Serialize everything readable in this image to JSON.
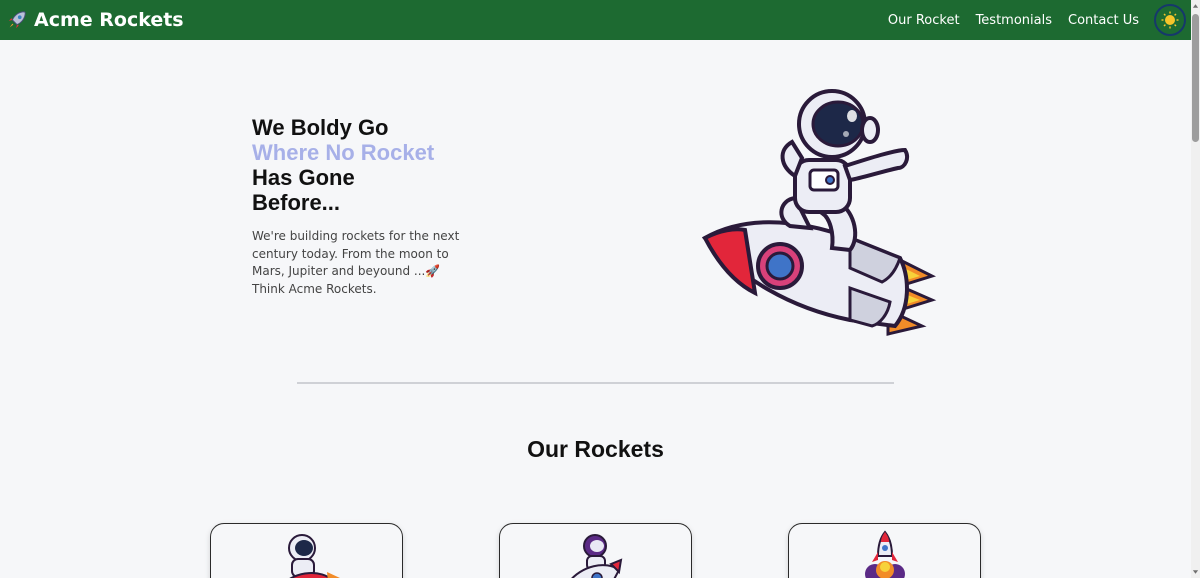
{
  "nav": {
    "brand": "Acme Rockets",
    "brand_icon": "rocket-icon",
    "links": [
      "Our Rocket",
      "Testmonials",
      "Contact Us"
    ],
    "theme_toggle_icon": "sun-icon",
    "colors": {
      "background": "#1d6a31",
      "text": "#ffffff"
    }
  },
  "hero": {
    "title_line1": "We Boldy Go",
    "title_accent": "Where No Rocket",
    "title_line3": "Has Gone",
    "title_line4": "Before...",
    "description": "We're building rockets for the next century today. From the moon to Mars, Jupiter and beyound ...🚀 Think Acme Rockets.",
    "illustration_icon": "astronaut-riding-rocket-icon",
    "accent_color": "#a7b0e8"
  },
  "rockets": {
    "title": "Our Rockets",
    "cards": [
      {
        "icon": "astronaut-rocket-icon"
      },
      {
        "icon": "astronaut-flying-rocket-icon"
      },
      {
        "icon": "rocket-launch-icon"
      }
    ]
  }
}
